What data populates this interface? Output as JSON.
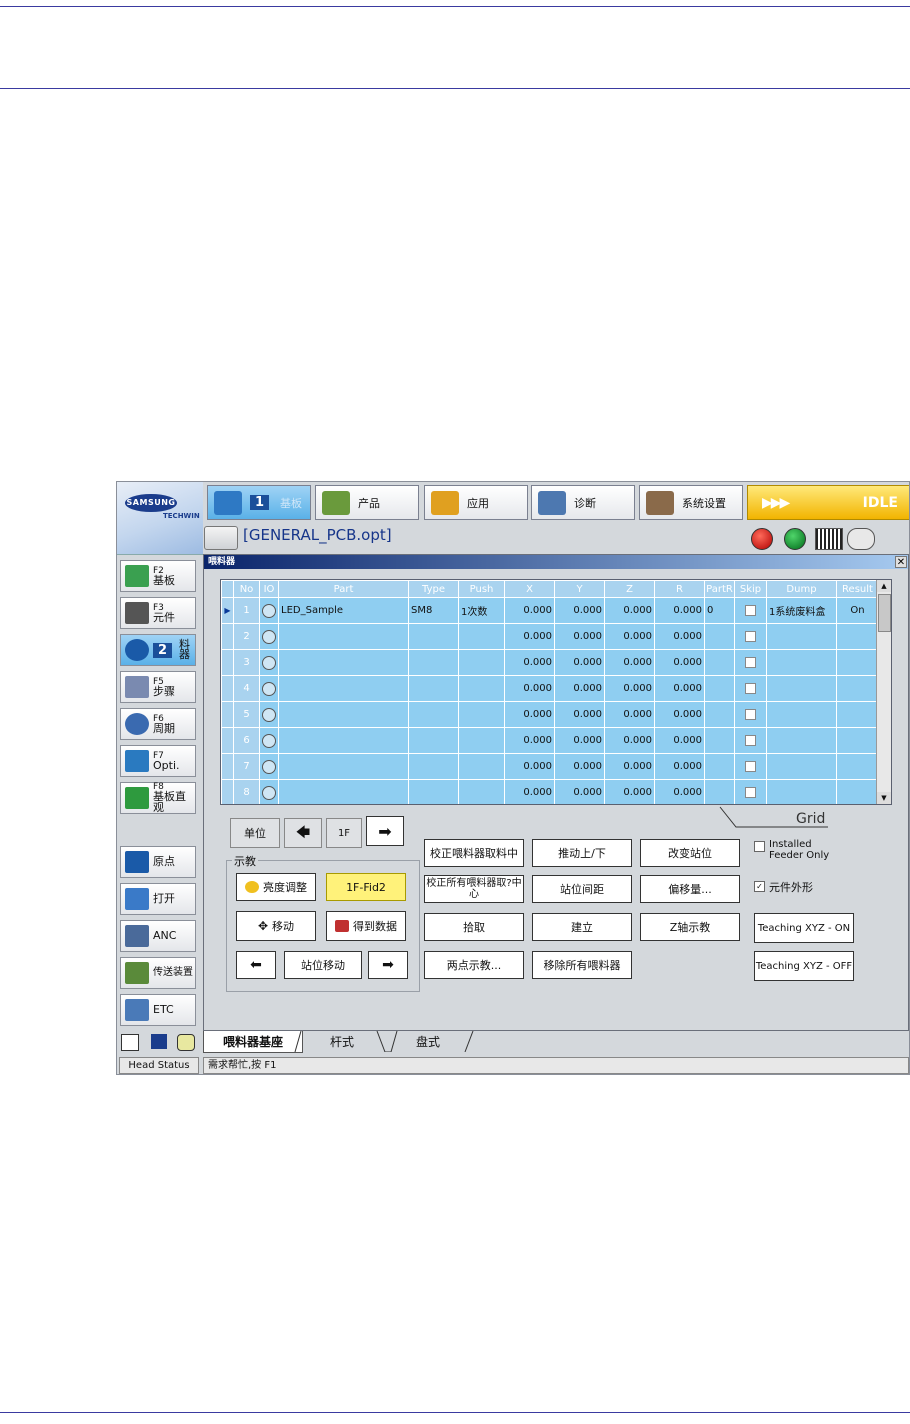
{
  "window": {
    "title": "喂料器"
  },
  "logo": {
    "brand": "SAMSUNG",
    "sub": "TECHWIN"
  },
  "top_menu": [
    {
      "label": "基板",
      "badge": "1"
    },
    {
      "label": "产品"
    },
    {
      "label": "应用"
    },
    {
      "label": "诊断"
    },
    {
      "label": "系统设置"
    }
  ],
  "status": {
    "arrows": "▶▶▶",
    "state": "IDLE"
  },
  "file": {
    "name": "[GENERAL_PCB.opt]"
  },
  "left_nav": [
    {
      "key": "F2",
      "label": "基板"
    },
    {
      "key": "F3",
      "label": "元件"
    },
    {
      "key": "2",
      "label": "料器"
    },
    {
      "key": "F5",
      "label": "步骤"
    },
    {
      "key": "F6",
      "label": "周期"
    },
    {
      "key": "F7",
      "label": "Opti."
    },
    {
      "key": "F8",
      "label": "基板直观"
    }
  ],
  "left_actions": [
    "原点",
    "打开",
    "ANC",
    "传送装置",
    "ETC"
  ],
  "grid": {
    "columns": [
      "No",
      "IO",
      "Part",
      "Type",
      "Push",
      "X",
      "Y",
      "Z",
      "R",
      "PartR",
      "Skip",
      "Dump",
      "Result"
    ],
    "rows": [
      {
        "no": "1",
        "part": "LED_Sample",
        "type": "SM8",
        "push": "1次数",
        "x": "0.000",
        "y": "0.000",
        "z": "0.000",
        "r": "0.000",
        "partr": "0",
        "dump": "1系统废料盒",
        "result": "On"
      },
      {
        "no": "2",
        "part": "",
        "type": "",
        "push": "",
        "x": "0.000",
        "y": "0.000",
        "z": "0.000",
        "r": "0.000",
        "partr": "",
        "dump": "",
        "result": ""
      },
      {
        "no": "3",
        "part": "",
        "type": "",
        "push": "",
        "x": "0.000",
        "y": "0.000",
        "z": "0.000",
        "r": "0.000",
        "partr": "",
        "dump": "",
        "result": ""
      },
      {
        "no": "4",
        "part": "",
        "type": "",
        "push": "",
        "x": "0.000",
        "y": "0.000",
        "z": "0.000",
        "r": "0.000",
        "partr": "",
        "dump": "",
        "result": ""
      },
      {
        "no": "5",
        "part": "",
        "type": "",
        "push": "",
        "x": "0.000",
        "y": "0.000",
        "z": "0.000",
        "r": "0.000",
        "partr": "",
        "dump": "",
        "result": ""
      },
      {
        "no": "6",
        "part": "",
        "type": "",
        "push": "",
        "x": "0.000",
        "y": "0.000",
        "z": "0.000",
        "r": "0.000",
        "partr": "",
        "dump": "",
        "result": ""
      },
      {
        "no": "7",
        "part": "",
        "type": "",
        "push": "",
        "x": "0.000",
        "y": "0.000",
        "z": "0.000",
        "r": "0.000",
        "partr": "",
        "dump": "",
        "result": ""
      },
      {
        "no": "8",
        "part": "",
        "type": "",
        "push": "",
        "x": "0.000",
        "y": "0.000",
        "z": "0.000",
        "r": "0.000",
        "partr": "",
        "dump": "",
        "result": ""
      }
    ],
    "annotation": "Grid"
  },
  "controls": {
    "unit_label": "单位",
    "feeder_no": "1F",
    "teach_group": "示教",
    "brightness": "亮度调整",
    "fid": "1F-Fid2",
    "move": "移动",
    "get_data": "得到数据",
    "station_move": "站位移动",
    "calib_center": "校正喂料器取料中",
    "calib_all": "校正所有喂料器取?中心",
    "pick": "拾取",
    "two_point": "两点示教...",
    "push_updown": "推动上/下",
    "station_pitch": "站位间距",
    "create": "建立",
    "remove_all": "移除所有喂料器",
    "change_station": "改变站位",
    "offset": "偏移量...",
    "z_teach": "Z轴示教",
    "installed_only": "Installed Feeder Only",
    "part_shape": "元件外形",
    "teach_on": "Teaching XYZ - ON",
    "teach_off": "Teaching XYZ - OFF"
  },
  "tabs": [
    "喂料器基座",
    "杆式",
    "盘式"
  ],
  "statusbar": {
    "head": "Head Status",
    "hint": "需求帮忙,按 F1"
  },
  "colors": {
    "grid_row": "#8fcef1",
    "grid_header": "#a9d3ef",
    "idle": "#f2b400",
    "nav_active": "#5ab1e8"
  }
}
